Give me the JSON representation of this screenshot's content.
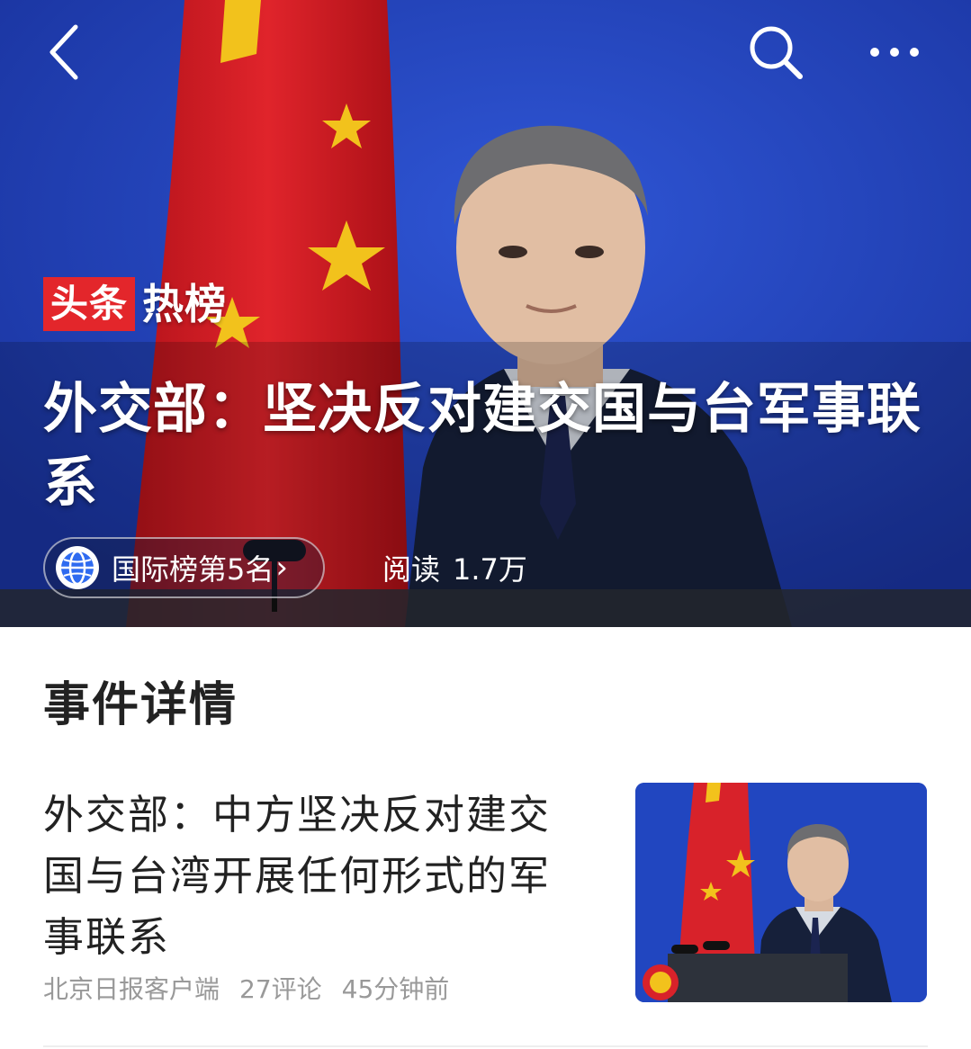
{
  "topbar": {
    "back_icon": "chevron-left-icon",
    "search_icon": "search-icon",
    "more_icon": "more-horizontal-icon"
  },
  "hero": {
    "brand_red": "头条",
    "brand_white": "热榜",
    "title": "外交部：坚决反对建交国与台军事联系",
    "rank_icon": "globe-icon",
    "rank_label": "国际榜第5名",
    "rank_arrow": "›",
    "reads_label": "阅读",
    "reads_value": "1.7万"
  },
  "section": {
    "title": "事件详情"
  },
  "article": {
    "title": "外交部：中方坚决反对建交国与台湾开展任何形式的军事联系",
    "source": "北京日报客户端",
    "comments": "27评论",
    "time": "45分钟前"
  },
  "colors": {
    "brand_red": "#e3262b",
    "hero_blue": "#2346bf",
    "text_dark": "#222222",
    "text_meta": "#999999"
  }
}
